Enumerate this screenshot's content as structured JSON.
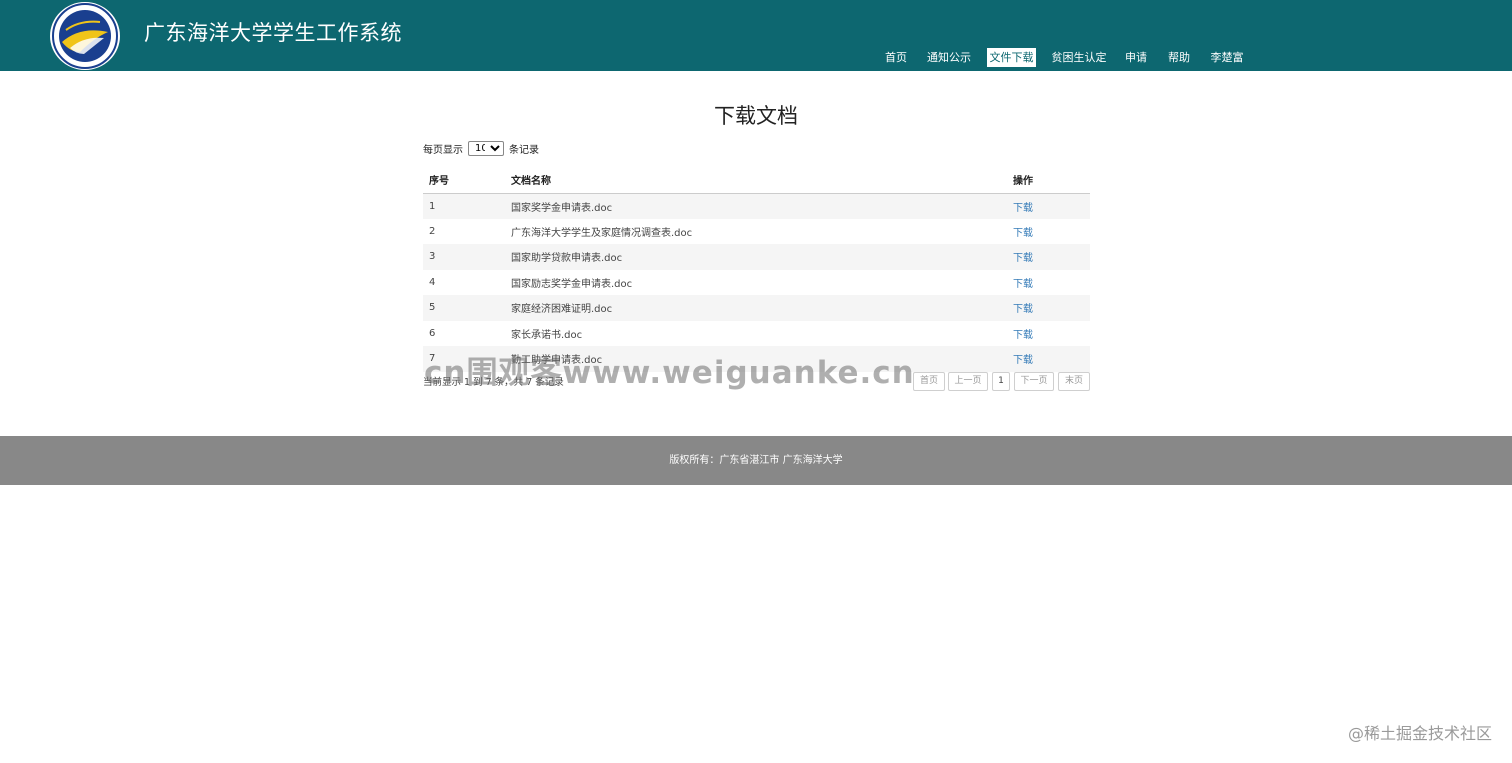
{
  "header": {
    "title": "广东海洋大学学生工作系统",
    "logo_name": "gdou-logo",
    "bg_color": "#0d6770"
  },
  "nav": {
    "items": [
      {
        "label": "首页",
        "active": false
      },
      {
        "label": "通知公示",
        "active": false
      },
      {
        "label": "文件下载",
        "active": true
      },
      {
        "label": "贫困生认定",
        "active": false
      },
      {
        "label": "申请",
        "active": false
      },
      {
        "label": "帮助",
        "active": false
      },
      {
        "label": "李楚富",
        "active": false
      }
    ]
  },
  "main": {
    "title": "下载文档",
    "page_size": {
      "prefix": "每页显示",
      "value": "10",
      "suffix": "条记录"
    },
    "table": {
      "headers": [
        "序号",
        "文档名称",
        "操作"
      ],
      "rows": [
        {
          "no": "1",
          "name": "国家奖学金申请表.doc",
          "action": "下载"
        },
        {
          "no": "2",
          "name": "广东海洋大学学生及家庭情况调查表.doc",
          "action": "下载"
        },
        {
          "no": "3",
          "name": "国家助学贷款申请表.doc",
          "action": "下载"
        },
        {
          "no": "4",
          "name": "国家励志奖学金申请表.doc",
          "action": "下载"
        },
        {
          "no": "5",
          "name": "家庭经济困难证明.doc",
          "action": "下载"
        },
        {
          "no": "6",
          "name": "家长承诺书.doc",
          "action": "下载"
        },
        {
          "no": "7",
          "name": "勤工助学申请表.doc",
          "action": "下载"
        }
      ]
    },
    "info": "当前显示 1 到 7 条，共 7 条记录",
    "pagination": [
      "首页",
      "上一页",
      "1",
      "下一页",
      "末页"
    ]
  },
  "watermark": "cn围观客www.weiguanke.cn",
  "footer": {
    "text": "版权所有：广东省湛江市   广东海洋大学"
  },
  "corner_mark": "@稀土掘金技术社区",
  "colors": {
    "header": "#0d6770",
    "footer": "#888888",
    "link": "#337ab7"
  }
}
